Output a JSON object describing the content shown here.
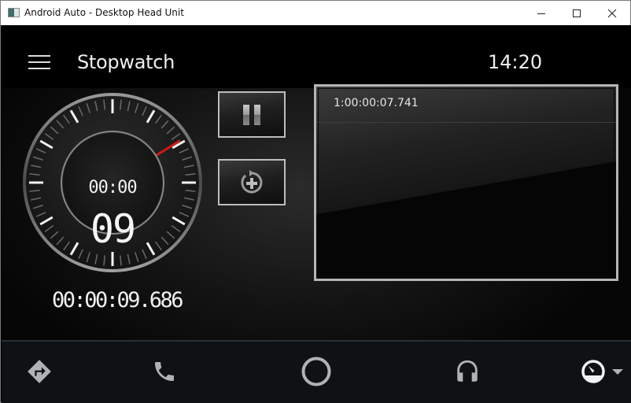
{
  "window": {
    "title": "Android Auto - Desktop Head Unit",
    "icons": {
      "app": "app-window-icon",
      "minimize": "minimize-icon",
      "maximize": "maximize-icon",
      "close": "close-icon"
    }
  },
  "header": {
    "menu_icon": "hamburger-menu-icon",
    "title": "Stopwatch",
    "clock": "14:20"
  },
  "stopwatch": {
    "dial_top_readout": "00:00",
    "dial_seconds": "09",
    "hand_seconds": 9.686,
    "total_time": "00:00:09.686",
    "accent_color": "#d01818",
    "buttons": {
      "pause": {
        "icon": "pause-icon"
      },
      "lap": {
        "icon": "add-lap-icon"
      }
    }
  },
  "laps": [
    {
      "text": "1:00:00:07.741"
    }
  ],
  "navbar": {
    "items": [
      {
        "name": "navigation",
        "icon": "navigation-directions-icon"
      },
      {
        "name": "phone",
        "icon": "phone-icon"
      },
      {
        "name": "home",
        "icon": "home-circle-icon"
      },
      {
        "name": "media",
        "icon": "headphones-icon"
      },
      {
        "name": "car",
        "icon": "speedometer-icon"
      }
    ],
    "dropdown_icon": "dropdown-arrow-icon"
  }
}
